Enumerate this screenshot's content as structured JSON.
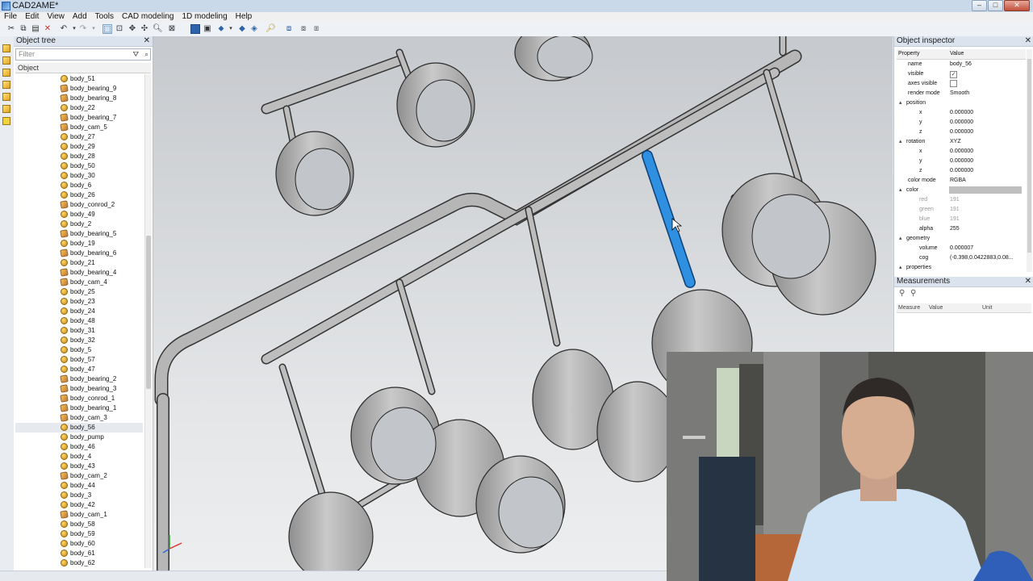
{
  "window": {
    "title": "CAD2AME*"
  },
  "menu": [
    "File",
    "Edit",
    "View",
    "Add",
    "Tools",
    "CAD modeling",
    "1D modeling",
    "Help"
  ],
  "object_tree": {
    "title": "Object tree",
    "filter_placeholder": "Filter",
    "column": "Object",
    "items": [
      {
        "label": "body_51",
        "kind": "body"
      },
      {
        "label": "body_bearing_9",
        "kind": "part"
      },
      {
        "label": "body_bearing_8",
        "kind": "part"
      },
      {
        "label": "body_22",
        "kind": "body"
      },
      {
        "label": "body_bearing_7",
        "kind": "part"
      },
      {
        "label": "body_cam_5",
        "kind": "part"
      },
      {
        "label": "body_27",
        "kind": "body"
      },
      {
        "label": "body_29",
        "kind": "body"
      },
      {
        "label": "body_28",
        "kind": "body"
      },
      {
        "label": "body_50",
        "kind": "body"
      },
      {
        "label": "body_30",
        "kind": "body"
      },
      {
        "label": "body_6",
        "kind": "body"
      },
      {
        "label": "body_26",
        "kind": "body"
      },
      {
        "label": "body_conrod_2",
        "kind": "part"
      },
      {
        "label": "body_49",
        "kind": "body"
      },
      {
        "label": "body_2",
        "kind": "body"
      },
      {
        "label": "body_bearing_5",
        "kind": "part"
      },
      {
        "label": "body_19",
        "kind": "body"
      },
      {
        "label": "body_bearing_6",
        "kind": "part"
      },
      {
        "label": "body_21",
        "kind": "body"
      },
      {
        "label": "body_bearing_4",
        "kind": "part"
      },
      {
        "label": "body_cam_4",
        "kind": "part"
      },
      {
        "label": "body_25",
        "kind": "body"
      },
      {
        "label": "body_23",
        "kind": "body"
      },
      {
        "label": "body_24",
        "kind": "body"
      },
      {
        "label": "body_48",
        "kind": "body"
      },
      {
        "label": "body_31",
        "kind": "body"
      },
      {
        "label": "body_32",
        "kind": "body"
      },
      {
        "label": "body_5",
        "kind": "body"
      },
      {
        "label": "body_57",
        "kind": "body"
      },
      {
        "label": "body_47",
        "kind": "body"
      },
      {
        "label": "body_bearing_2",
        "kind": "part"
      },
      {
        "label": "body_bearing_3",
        "kind": "part"
      },
      {
        "label": "body_conrod_1",
        "kind": "part"
      },
      {
        "label": "body_bearing_1",
        "kind": "part"
      },
      {
        "label": "body_cam_3",
        "kind": "part"
      },
      {
        "label": "body_56",
        "kind": "body",
        "selected": true
      },
      {
        "label": "body_pump",
        "kind": "body"
      },
      {
        "label": "body_46",
        "kind": "body"
      },
      {
        "label": "body_4",
        "kind": "body"
      },
      {
        "label": "body_43",
        "kind": "body"
      },
      {
        "label": "body_cam_2",
        "kind": "part"
      },
      {
        "label": "body_44",
        "kind": "body"
      },
      {
        "label": "body_3",
        "kind": "body"
      },
      {
        "label": "body_42",
        "kind": "body"
      },
      {
        "label": "body_cam_1",
        "kind": "part"
      },
      {
        "label": "body_58",
        "kind": "body"
      },
      {
        "label": "body_59",
        "kind": "body"
      },
      {
        "label": "body_60",
        "kind": "body"
      },
      {
        "label": "body_61",
        "kind": "body"
      },
      {
        "label": "body_62",
        "kind": "body"
      }
    ]
  },
  "inspector": {
    "title": "Object inspector",
    "col_property": "Property",
    "col_value": "Value",
    "rows": [
      {
        "k": "name",
        "v": "body_56",
        "lvl": 1
      },
      {
        "k": "visible",
        "v": "✓",
        "lvl": 1,
        "check": true
      },
      {
        "k": "axes visible",
        "v": "",
        "lvl": 1,
        "check": true
      },
      {
        "k": "render mode",
        "v": "Smooth",
        "lvl": 1
      },
      {
        "k": "position",
        "v": "",
        "lvl": 1,
        "group": true
      },
      {
        "k": "x",
        "v": "0.000000",
        "lvl": 2
      },
      {
        "k": "y",
        "v": "0.000000",
        "lvl": 2
      },
      {
        "k": "z",
        "v": "0.000000",
        "lvl": 2
      },
      {
        "k": "rotation",
        "v": "XYZ",
        "lvl": 1,
        "group": true
      },
      {
        "k": "x",
        "v": "0.000000",
        "lvl": 2
      },
      {
        "k": "y",
        "v": "0.000000",
        "lvl": 2
      },
      {
        "k": "z",
        "v": "0.000000",
        "lvl": 2
      },
      {
        "k": "color mode",
        "v": "RGBA",
        "lvl": 1
      },
      {
        "k": "color",
        "v": "",
        "lvl": 1,
        "group": true,
        "swatch": "#bfbfbf"
      },
      {
        "k": "red",
        "v": "191",
        "lvl": 2,
        "dim": true
      },
      {
        "k": "green",
        "v": "191",
        "lvl": 2,
        "dim": true
      },
      {
        "k": "blue",
        "v": "191",
        "lvl": 2,
        "dim": true
      },
      {
        "k": "alpha",
        "v": "255",
        "lvl": 2
      },
      {
        "k": "geometry",
        "v": "",
        "lvl": 1,
        "group": true
      },
      {
        "k": "volume",
        "v": "0.000007",
        "lvl": 2
      },
      {
        "k": "cog",
        "v": "(-0.398,0.0422883,0.08...",
        "lvl": 2
      },
      {
        "k": "properties",
        "v": "",
        "lvl": 1,
        "group": true
      }
    ]
  },
  "measurements": {
    "title": "Measurements",
    "cols": [
      "Measure",
      "Value",
      "Unit"
    ]
  },
  "colors": {
    "selected_part": "#2f8fe0",
    "pipe": "#b4b4b4",
    "pipe_edge": "#3a3a3a"
  }
}
